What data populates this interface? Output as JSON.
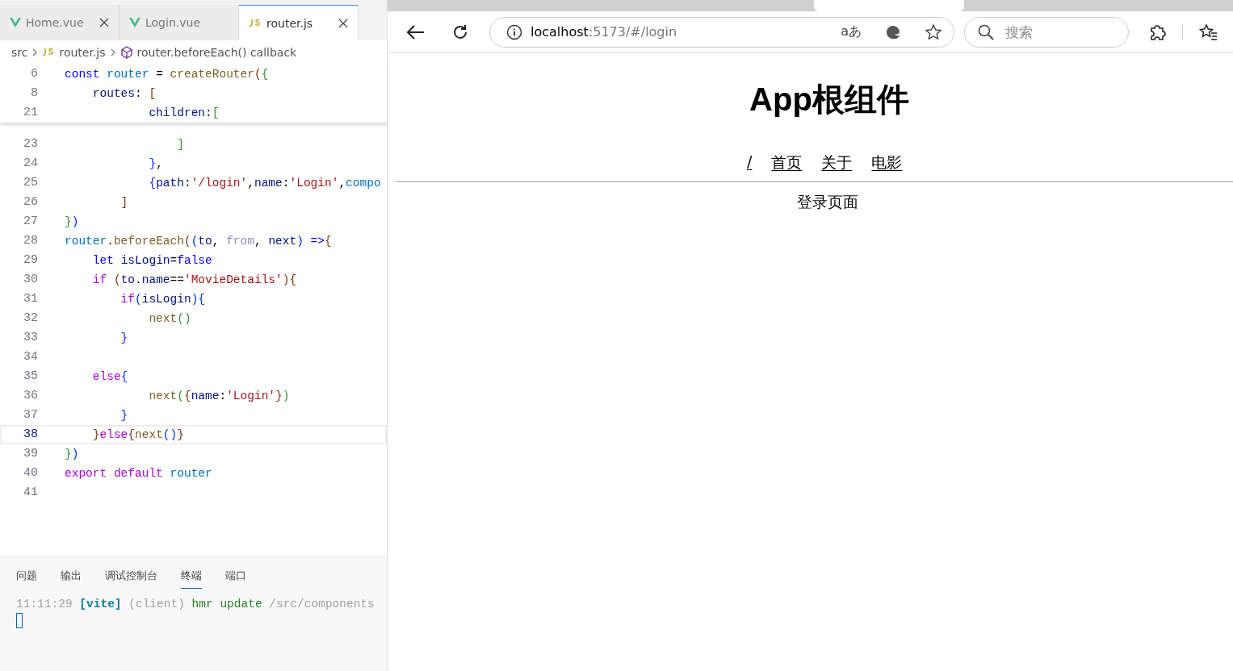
{
  "editor": {
    "tabs": [
      {
        "label": "Home.vue",
        "kind": "vue",
        "selected": false,
        "closable": true
      },
      {
        "label": "Login.vue",
        "kind": "vue",
        "selected": false,
        "closable": false
      },
      {
        "label": "router.js",
        "kind": "js",
        "selected": true,
        "closable": true
      }
    ],
    "breadcrumb": [
      {
        "text": "src",
        "kind": "folder"
      },
      {
        "text": "router.js",
        "kind": "js"
      },
      {
        "text": "router.beforeEach() callback",
        "kind": "symbol"
      }
    ],
    "sticky_lines": [
      {
        "number": "6",
        "tokens": [
          {
            "text": "const ",
            "kind": "kw"
          },
          {
            "text": "router",
            "kind": "cv"
          },
          {
            "text": " = ",
            "kind": "p"
          },
          {
            "text": "createRouter",
            "kind": "fn"
          },
          {
            "text": "(",
            "kind": "b3"
          },
          {
            "text": "{",
            "kind": "b2"
          }
        ]
      },
      {
        "number": "8",
        "tokens": [
          {
            "text": "    routes",
            "kind": "var"
          },
          {
            "text": ": ",
            "kind": "p"
          },
          {
            "text": "[",
            "kind": "b3"
          }
        ]
      },
      {
        "number": "21",
        "tokens": [
          {
            "text": "            children",
            "kind": "var"
          },
          {
            "text": ":",
            "kind": "p"
          },
          {
            "text": "[",
            "kind": "b2"
          }
        ]
      }
    ],
    "lines": [
      {
        "number": "23",
        "current": false,
        "tokens": [
          {
            "text": "                ]",
            "kind": "b2"
          }
        ]
      },
      {
        "number": "24",
        "current": false,
        "tokens": [
          {
            "text": "            }",
            "kind": "b1"
          },
          {
            "text": ",",
            "kind": "p"
          }
        ]
      },
      {
        "number": "25",
        "current": false,
        "tokens": [
          {
            "text": "            {",
            "kind": "b1"
          },
          {
            "text": "path",
            "kind": "var"
          },
          {
            "text": ":",
            "kind": "p"
          },
          {
            "text": "'/login'",
            "kind": "str"
          },
          {
            "text": ",",
            "kind": "p"
          },
          {
            "text": "name",
            "kind": "var"
          },
          {
            "text": ":",
            "kind": "p"
          },
          {
            "text": "'Login'",
            "kind": "str"
          },
          {
            "text": ",",
            "kind": "p"
          },
          {
            "text": "compo",
            "kind": "cv"
          }
        ]
      },
      {
        "number": "26",
        "current": false,
        "tokens": [
          {
            "text": "        ]",
            "kind": "b3"
          }
        ]
      },
      {
        "number": "27",
        "current": false,
        "tokens": [
          {
            "text": "}",
            "kind": "b2"
          },
          {
            "text": ")",
            "kind": "b1"
          }
        ]
      },
      {
        "number": "28",
        "current": false,
        "tokens": [
          {
            "text": "router",
            "kind": "cv"
          },
          {
            "text": ".",
            "kind": "p"
          },
          {
            "text": "beforeEach",
            "kind": "fn"
          },
          {
            "text": "(",
            "kind": "b3"
          },
          {
            "text": "(",
            "kind": "b1"
          },
          {
            "text": "to",
            "kind": "var"
          },
          {
            "text": ", ",
            "kind": "p"
          },
          {
            "text": "from",
            "kind": "unused"
          },
          {
            "text": ", ",
            "kind": "p"
          },
          {
            "text": "next",
            "kind": "var"
          },
          {
            "text": ") ",
            "kind": "b1"
          },
          {
            "text": "=>",
            "kind": "kw"
          },
          {
            "text": "{",
            "kind": "b3"
          }
        ]
      },
      {
        "number": "29",
        "current": false,
        "tokens": [
          {
            "text": "    let ",
            "kind": "kw"
          },
          {
            "text": "isLogin",
            "kind": "var"
          },
          {
            "text": "=",
            "kind": "p"
          },
          {
            "text": "false",
            "kind": "kw"
          }
        ]
      },
      {
        "number": "30",
        "current": false,
        "tokens": [
          {
            "text": "    if ",
            "kind": "ctrl"
          },
          {
            "text": "(",
            "kind": "b3"
          },
          {
            "text": "to",
            "kind": "var"
          },
          {
            "text": ".",
            "kind": "p"
          },
          {
            "text": "name",
            "kind": "var"
          },
          {
            "text": "==",
            "kind": "p"
          },
          {
            "text": "'MovieDetails'",
            "kind": "str"
          },
          {
            "text": ")",
            "kind": "b3"
          },
          {
            "text": "{",
            "kind": "b3"
          }
        ]
      },
      {
        "number": "31",
        "current": false,
        "tokens": [
          {
            "text": "        if",
            "kind": "ctrl"
          },
          {
            "text": "(",
            "kind": "b1"
          },
          {
            "text": "isLogin",
            "kind": "var"
          },
          {
            "text": ")",
            "kind": "b1"
          },
          {
            "text": "{",
            "kind": "b1"
          }
        ]
      },
      {
        "number": "32",
        "current": false,
        "tokens": [
          {
            "text": "            next",
            "kind": "fn"
          },
          {
            "text": "(",
            "kind": "b2"
          },
          {
            "text": ")",
            "kind": "b2"
          }
        ]
      },
      {
        "number": "33",
        "current": false,
        "tokens": [
          {
            "text": "        }",
            "kind": "b1"
          }
        ]
      },
      {
        "number": "34",
        "current": false
      },
      {
        "number": "35",
        "current": false,
        "tokens": [
          {
            "text": "    else",
            "kind": "ctrl"
          },
          {
            "text": "{",
            "kind": "b1"
          }
        ]
      },
      {
        "number": "36",
        "current": false,
        "tokens": [
          {
            "text": "            next",
            "kind": "fn"
          },
          {
            "text": "(",
            "kind": "b2"
          },
          {
            "text": "{",
            "kind": "b3"
          },
          {
            "text": "name",
            "kind": "var"
          },
          {
            "text": ":",
            "kind": "p"
          },
          {
            "text": "'Login'",
            "kind": "str"
          },
          {
            "text": "}",
            "kind": "b3"
          },
          {
            "text": ")",
            "kind": "b2"
          }
        ]
      },
      {
        "number": "37",
        "current": false,
        "tokens": [
          {
            "text": "        }",
            "kind": "b1"
          }
        ]
      },
      {
        "number": "38",
        "current": true,
        "tokens": [
          {
            "text": "    }",
            "kind": "b3"
          },
          {
            "text": "else",
            "kind": "ctrl"
          },
          {
            "text": "{",
            "kind": "b3"
          },
          {
            "text": "next",
            "kind": "fn"
          },
          {
            "text": "(",
            "kind": "b1"
          },
          {
            "text": ")",
            "kind": "b1"
          },
          {
            "text": "}",
            "kind": "b3"
          }
        ]
      },
      {
        "number": "39",
        "current": false,
        "tokens": [
          {
            "text": "}",
            "kind": "b2"
          },
          {
            "text": ")",
            "kind": "b1"
          }
        ]
      },
      {
        "number": "40",
        "current": false,
        "tokens": [
          {
            "text": "export default ",
            "kind": "ctrl"
          },
          {
            "text": "router",
            "kind": "cv"
          }
        ]
      },
      {
        "number": "41",
        "current": false
      }
    ]
  },
  "panel": {
    "tabs": [
      {
        "label": "问题",
        "selected": false
      },
      {
        "label": "输出",
        "selected": false
      },
      {
        "label": "调试控制台",
        "selected": false
      },
      {
        "label": "终端",
        "selected": true
      },
      {
        "label": "端口",
        "selected": false
      }
    ],
    "terminal": {
      "tokens": [
        {
          "text": "11:11:29 ",
          "kind": "time"
        },
        {
          "text": "[vite] ",
          "kind": "tag"
        },
        {
          "text": "(client) ",
          "kind": "dim"
        },
        {
          "text": "hmr update ",
          "kind": "ok"
        },
        {
          "text": "/src/components",
          "kind": "dim"
        }
      ]
    }
  },
  "browser": {
    "address": {
      "host": "localhost",
      "rest": ":5173/#/login"
    },
    "read_aloud": "aあ",
    "search": {
      "placeholder": "搜索"
    },
    "page": {
      "title": "App根组件",
      "nav": [
        "/",
        "首页",
        "关于",
        "电影"
      ],
      "content": "登录页面"
    }
  }
}
